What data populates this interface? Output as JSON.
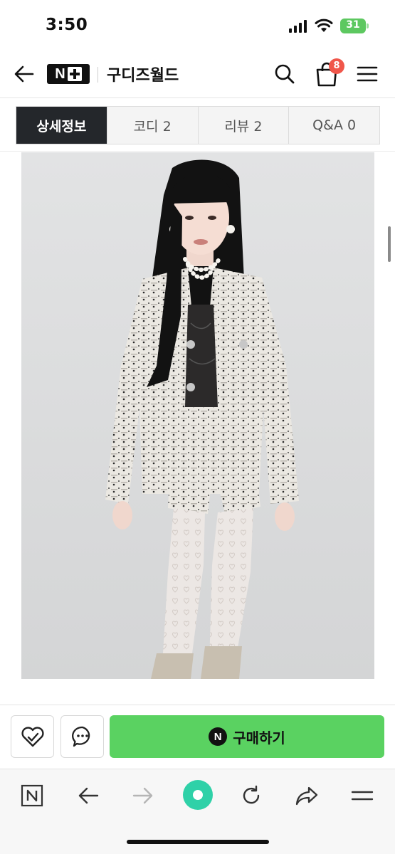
{
  "status_bar": {
    "time": "3:50",
    "battery": "31"
  },
  "header": {
    "logo": "N+",
    "store_name": "구디즈월드",
    "cart_count": "8",
    "icons": [
      "arrow-left-icon",
      "search-icon",
      "shopping-bag-icon",
      "hamburger-menu-icon"
    ]
  },
  "tabs": [
    {
      "label": "상세정보",
      "active": true
    },
    {
      "label": "코디 2",
      "active": false
    },
    {
      "label": "리뷰 2",
      "active": false
    },
    {
      "label": "Q&A 0",
      "active": false
    }
  ],
  "purchase_bar": {
    "buy_label": "구매하기",
    "buy_badge": "N",
    "accent": "#5ad261"
  },
  "browser_toolbar": {
    "icons": [
      "naver-n-icon",
      "back-arrow-icon",
      "forward-arrow-icon",
      "green-dot-icon",
      "reload-icon",
      "share-icon",
      "menu-icon"
    ],
    "accent": "#2fd1a8"
  },
  "colors": {
    "active_tab": "#24272b",
    "badge": "#f0564a",
    "battery": "#5dc860"
  }
}
